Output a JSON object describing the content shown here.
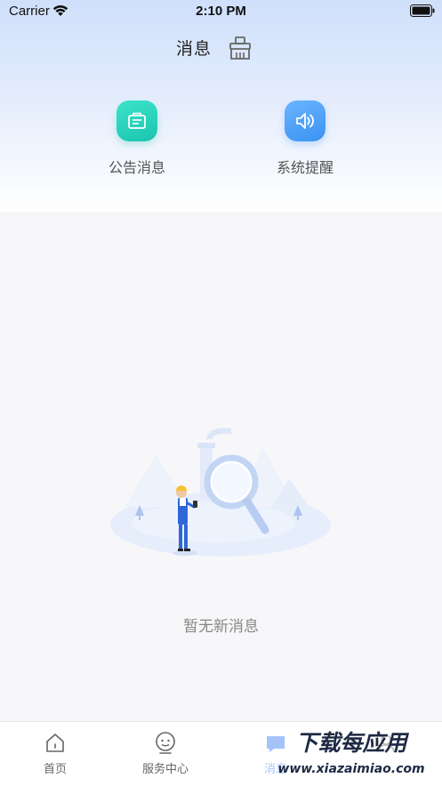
{
  "status_bar": {
    "carrier": "Carrier",
    "time": "2:10 PM"
  },
  "nav": {
    "title": "消息",
    "clean_icon": "broom-icon"
  },
  "categories": [
    {
      "label": "公告消息",
      "icon": "notice-icon",
      "color": "#1fc9b4"
    },
    {
      "label": "系统提醒",
      "icon": "speaker-icon",
      "color": "#4aa0f7"
    }
  ],
  "empty_state": {
    "text": "暂无新消息"
  },
  "tab_bar": {
    "items": [
      {
        "label": "首页",
        "icon": "home-icon"
      },
      {
        "label": "服务中心",
        "icon": "service-icon"
      },
      {
        "label": "消息",
        "icon": "message-icon",
        "active": true
      },
      {
        "label": "",
        "icon": "mine-icon"
      }
    ]
  },
  "watermark": {
    "title": "下载每应用",
    "url": "www.xiazaimiao.com"
  },
  "colors": {
    "accent": "#3a7bf2",
    "header_gradient_top": "#cfe0fb"
  }
}
